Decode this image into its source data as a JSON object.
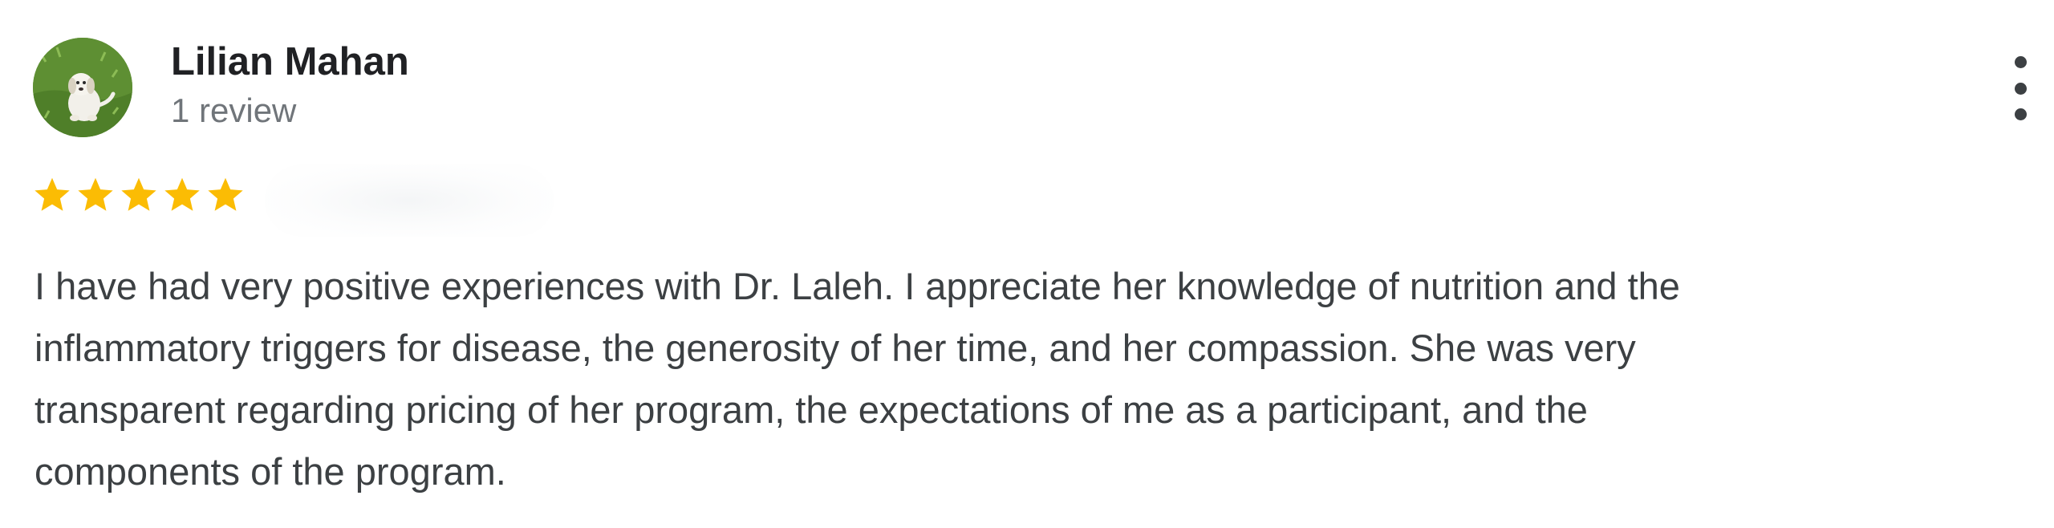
{
  "reviewer": {
    "name": "Lilian Mahan",
    "review_count": "1 review",
    "avatar_icon": "dog-photo-avatar"
  },
  "rating": {
    "stars": 5,
    "max": 5,
    "color": "#fbbc04"
  },
  "review": {
    "lines": [
      "I have had very positive experiences with Dr. Laleh. I appreciate her knowledge of nutrition and the",
      "inflammatory triggers for disease, the generosity of her time, and her compassion. She was very",
      "transparent regarding pricing of her program, the expectations of me as a participant, and the",
      "components of the program."
    ]
  },
  "menu": {
    "icon": "more-vert-icon"
  }
}
